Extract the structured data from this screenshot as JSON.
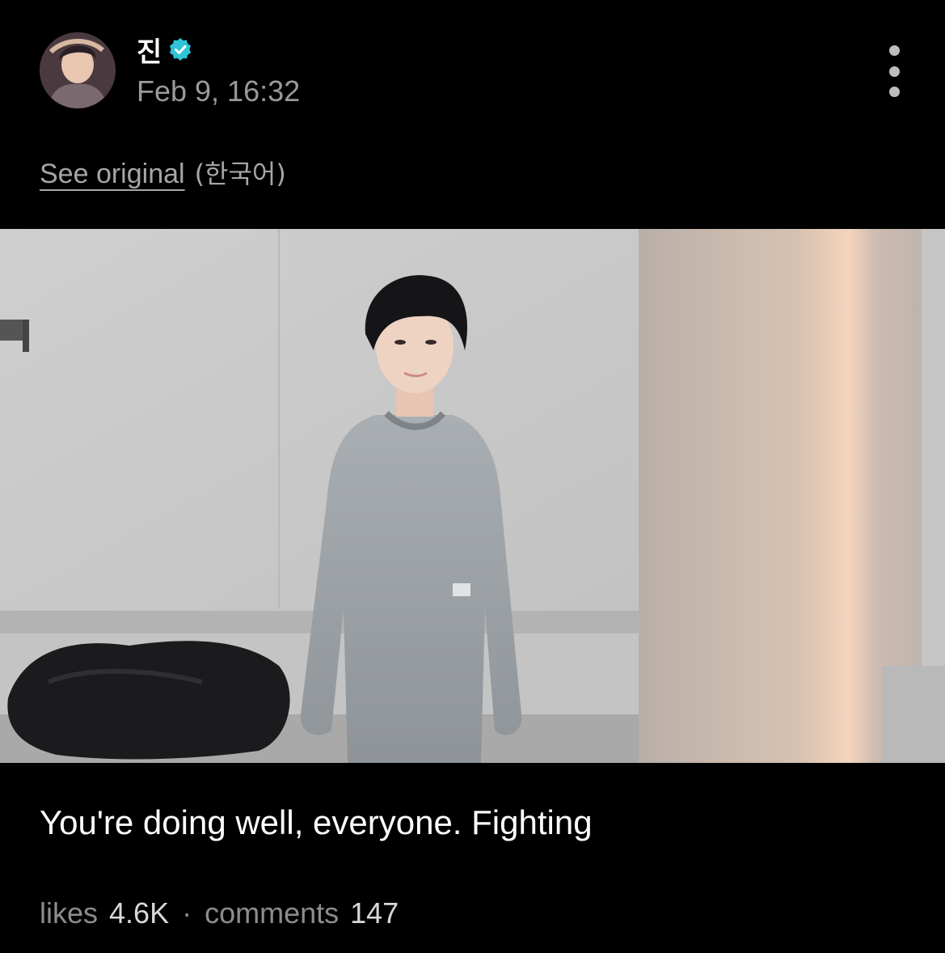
{
  "post": {
    "author": "진",
    "verified": true,
    "timestamp": "Feb 9, 16:32",
    "translation": {
      "see_original_label": "See original",
      "language": "(한국어)"
    },
    "caption": "You're doing well, everyone. Fighting",
    "stats": {
      "likes_label": "likes",
      "likes_value": "4.6K",
      "separator": "·",
      "comments_label": "comments",
      "comments_value": "147"
    }
  },
  "icons": {
    "verified": "verified-badge-icon",
    "more": "more-vertical-icon"
  },
  "colors": {
    "background": "#000000",
    "verified_badge": "#2ec4d6",
    "secondary_text": "#9a9a9a"
  }
}
